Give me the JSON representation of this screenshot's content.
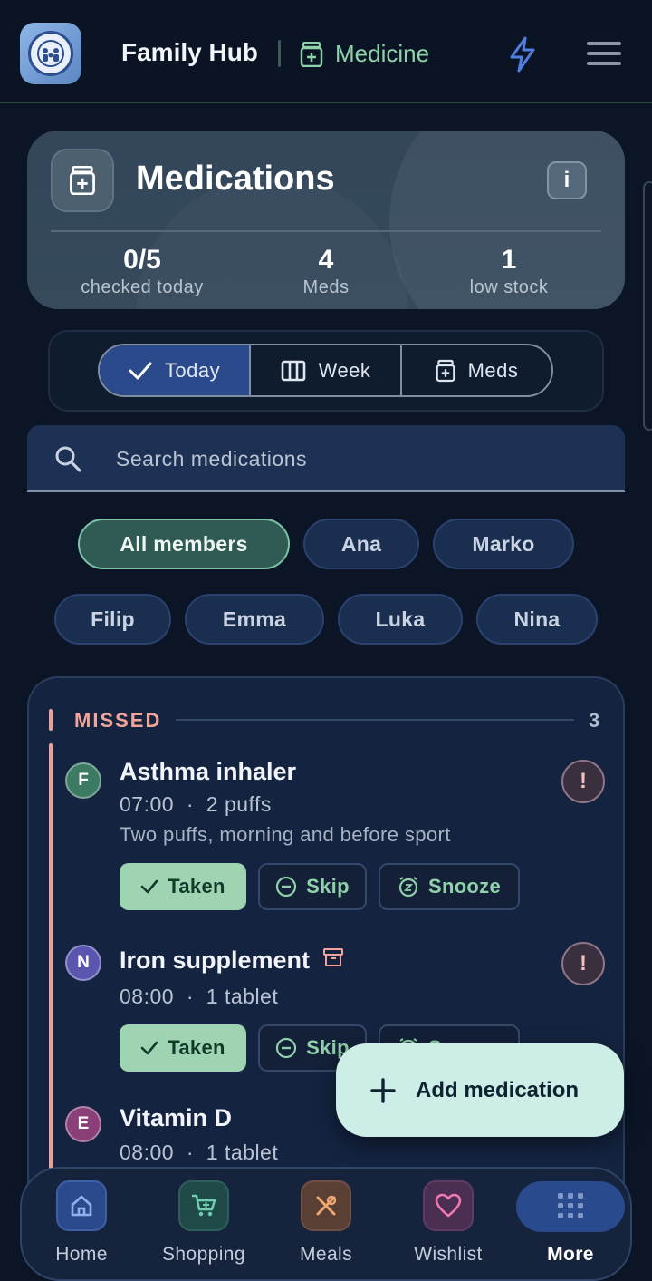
{
  "appbar": {
    "title": "Family Hub",
    "section": "Medicine",
    "icons": {
      "logo": "family-logo-icon",
      "section": "medicine-icon",
      "quick": "bolt-icon",
      "menu": "hamburger-menu-icon"
    }
  },
  "summary": {
    "title": "Medications",
    "info_label": "i",
    "stats": [
      {
        "value": "0/5",
        "label": "checked today"
      },
      {
        "value": "4",
        "label": "Meds"
      },
      {
        "value": "1",
        "label": "low stock"
      }
    ]
  },
  "tabs": [
    {
      "label": "Today",
      "icon": "check-icon",
      "active": true
    },
    {
      "label": "Week",
      "icon": "columns-icon",
      "active": false
    },
    {
      "label": "Meds",
      "icon": "medicine-icon",
      "active": false
    }
  ],
  "search": {
    "placeholder": "Search medications",
    "value": ""
  },
  "members": [
    {
      "label": "All members",
      "active": true
    },
    {
      "label": "Ana",
      "active": false
    },
    {
      "label": "Marko",
      "active": false
    },
    {
      "label": "Filip",
      "active": false
    },
    {
      "label": "Emma",
      "active": false
    },
    {
      "label": "Luka",
      "active": false
    },
    {
      "label": "Nina",
      "active": false
    }
  ],
  "missed": {
    "label": "MISSED",
    "count": "3",
    "items": [
      {
        "initial": "F",
        "name": "Asthma inhaler",
        "time": "07:00",
        "dose": "2 puffs",
        "note": "Two puffs, morning and before sport",
        "alert": "!",
        "color": "#3d7a63"
      },
      {
        "initial": "N",
        "name": "Iron supplement",
        "time": "08:00",
        "dose": "1 tablet",
        "note": "",
        "alert": "!",
        "color": "#5a56b0"
      },
      {
        "initial": "E",
        "name": "Vitamin D",
        "time": "08:00",
        "dose": "1 tablet",
        "note": "",
        "alert": "",
        "color": "#8a3f78"
      }
    ],
    "actions": {
      "taken": "Taken",
      "skip": "Skip",
      "snooze": "Snooze"
    },
    "separator": "·"
  },
  "fab": {
    "label": "Add medication"
  },
  "nav": [
    {
      "label": "Home",
      "icon": "home-icon",
      "color": "#2a4a8c"
    },
    {
      "label": "Shopping",
      "icon": "cart-icon",
      "color": "#1f4a47"
    },
    {
      "label": "Meals",
      "icon": "utensils-icon",
      "color": "#5a3f35"
    },
    {
      "label": "Wishlist",
      "icon": "heart-icon",
      "color": "#4a2f52"
    },
    {
      "label": "More",
      "icon": "grid-icon",
      "color": "#2a4a8e"
    }
  ],
  "colors": {
    "accent_green": "#8fd1a8",
    "missed": "#f1a59a",
    "primary_blue": "#2b4a8c"
  }
}
